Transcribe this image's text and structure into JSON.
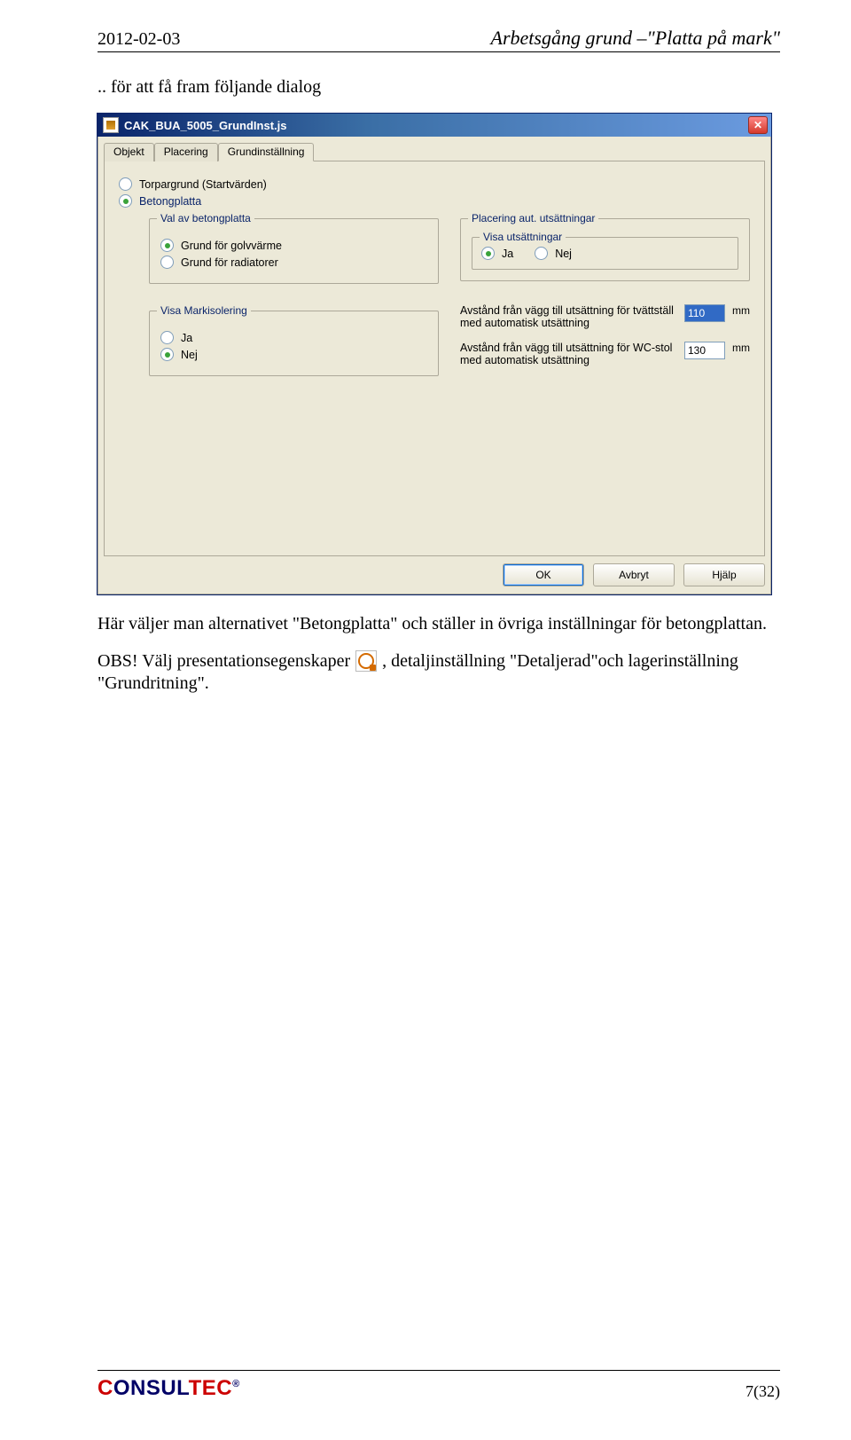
{
  "header": {
    "date": "2012-02-03",
    "title": "Arbetsgång grund –\"Platta på mark\""
  },
  "intro": ".. för att få fram följande dialog",
  "dialog": {
    "title": "CAK_BUA_5005_GrundInst.js",
    "tabs": {
      "objekt": "Objekt",
      "placering": "Placering",
      "grund": "Grundinställning"
    },
    "torpar": "Torpargrund (Startvärden)",
    "betong": "Betongplatta",
    "valLegend": "Val av betongplatta",
    "valGolv": "Grund för golvvärme",
    "valRad": "Grund för radiatorer",
    "placLegend": "Placering aut. utsättningar",
    "visaLegend": "Visa utsättningar",
    "ja": "Ja",
    "nej": "Nej",
    "markLegend": "Visa Markisolering",
    "avst1": "Avstånd från vägg till utsättning för tvättställ med automatisk utsättning",
    "avst1val": "110",
    "avst2": "Avstånd från vägg till utsättning för WC-stol med automatisk utsättning",
    "avst2val": "130",
    "unit": "mm",
    "buttons": {
      "ok": "OK",
      "avbryt": "Avbryt",
      "hjalp": "Hjälp"
    }
  },
  "afterDialog": "Här väljer man alternativet \"Betongplatta\" och ställer in övriga inställningar för betongplattan.",
  "obs": {
    "pre": "OBS! Välj presentationsegenskaper",
    "post": ", detaljinställning \"Detaljerad\"och lagerinställning",
    "line2": "\"Grundritning\"."
  },
  "footer": {
    "logo1": "C",
    "logo2": "ONSUL",
    "logo3": "TEC",
    "reg": "®",
    "pagenum": "7(32)"
  }
}
